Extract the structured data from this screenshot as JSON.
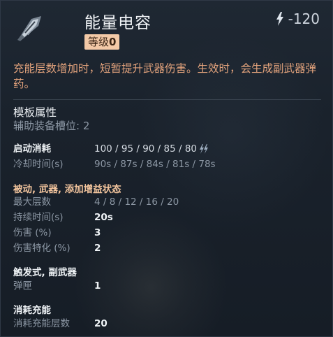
{
  "item": {
    "name": "能量电容",
    "level_prefix": "等级",
    "level_value": "0",
    "energy_cost": "-120",
    "description": "充能层数增加时，短暂提升武器伤害。生效时，会生成副武器弹药。",
    "icon": "capacitor-icon"
  },
  "template": {
    "title": "模板属性",
    "slot_line": "辅助装备槽位: 2"
  },
  "stats": {
    "activation_cost_label": "启动消耗",
    "activation_cost_value": "100 / 95 / 90 / 85 / 80",
    "cooldown_label": "冷却时间(s)",
    "cooldown_value": "90s / 87s / 84s / 81s / 78s"
  },
  "passive": {
    "title": "被动, 武器, 添加增益状态",
    "max_stacks_label": "最大层数",
    "max_stacks_value": "4 / 8 / 12 / 16 / 20",
    "duration_label": "持续时间(s)",
    "duration_value": "20s",
    "damage_label": "伤害 (%)",
    "damage_value": "3",
    "damage_spec_label": "伤害特化 (%)",
    "damage_spec_value": "2"
  },
  "trigger": {
    "title": "触发式, 副武器",
    "magazine_label": "弹匣",
    "magazine_value": "1"
  },
  "consume": {
    "title": "消耗充能",
    "stacks_label": "消耗充能层数",
    "stacks_value": "20"
  },
  "colors": {
    "accent_orange": "#e3a37c",
    "badge_bg": "#f3c9a7",
    "panel_bg": "#1a222c"
  }
}
